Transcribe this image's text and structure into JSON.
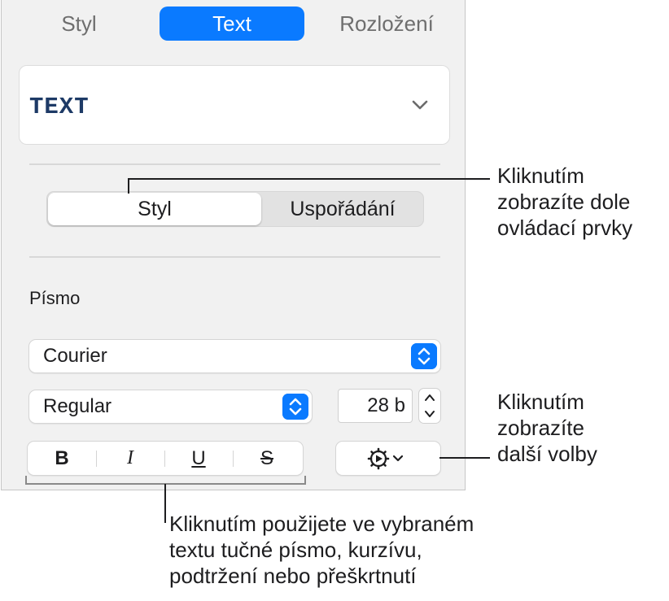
{
  "tabs": [
    {
      "label": "Styl",
      "selected": false
    },
    {
      "label": "Text",
      "selected": true
    },
    {
      "label": "Rozložení",
      "selected": false
    }
  ],
  "paragraph_style": {
    "name": "TEXT",
    "icon": "chevron-down-icon"
  },
  "segmented": {
    "left_label": "Styl",
    "right_label": "Uspořádání",
    "selected": "Styl"
  },
  "font_section": {
    "label": "Písmo",
    "font_family": "Courier",
    "typeface": "Regular",
    "size": "28 b"
  },
  "text_style_buttons": {
    "bold": "B",
    "italic": "I",
    "underline": "U",
    "strikethrough": "S"
  },
  "advanced_options": {
    "icon": "gear-icon"
  },
  "callouts": {
    "segmented": [
      "Kliknutím",
      "zobrazíte dole",
      "ovládací prvky"
    ],
    "gear": [
      "Kliknutím",
      "zobrazíte",
      "další volby"
    ],
    "buttons": [
      "Kliknutím použijete ve vybraném",
      "textu tučné písmo, kurzívu,",
      "podtržení nebo přeškrtnutí"
    ]
  },
  "colors": {
    "accent": "#0a7aff",
    "panel_bg": "#f1f1f1",
    "style_name": "#1d3a66"
  }
}
